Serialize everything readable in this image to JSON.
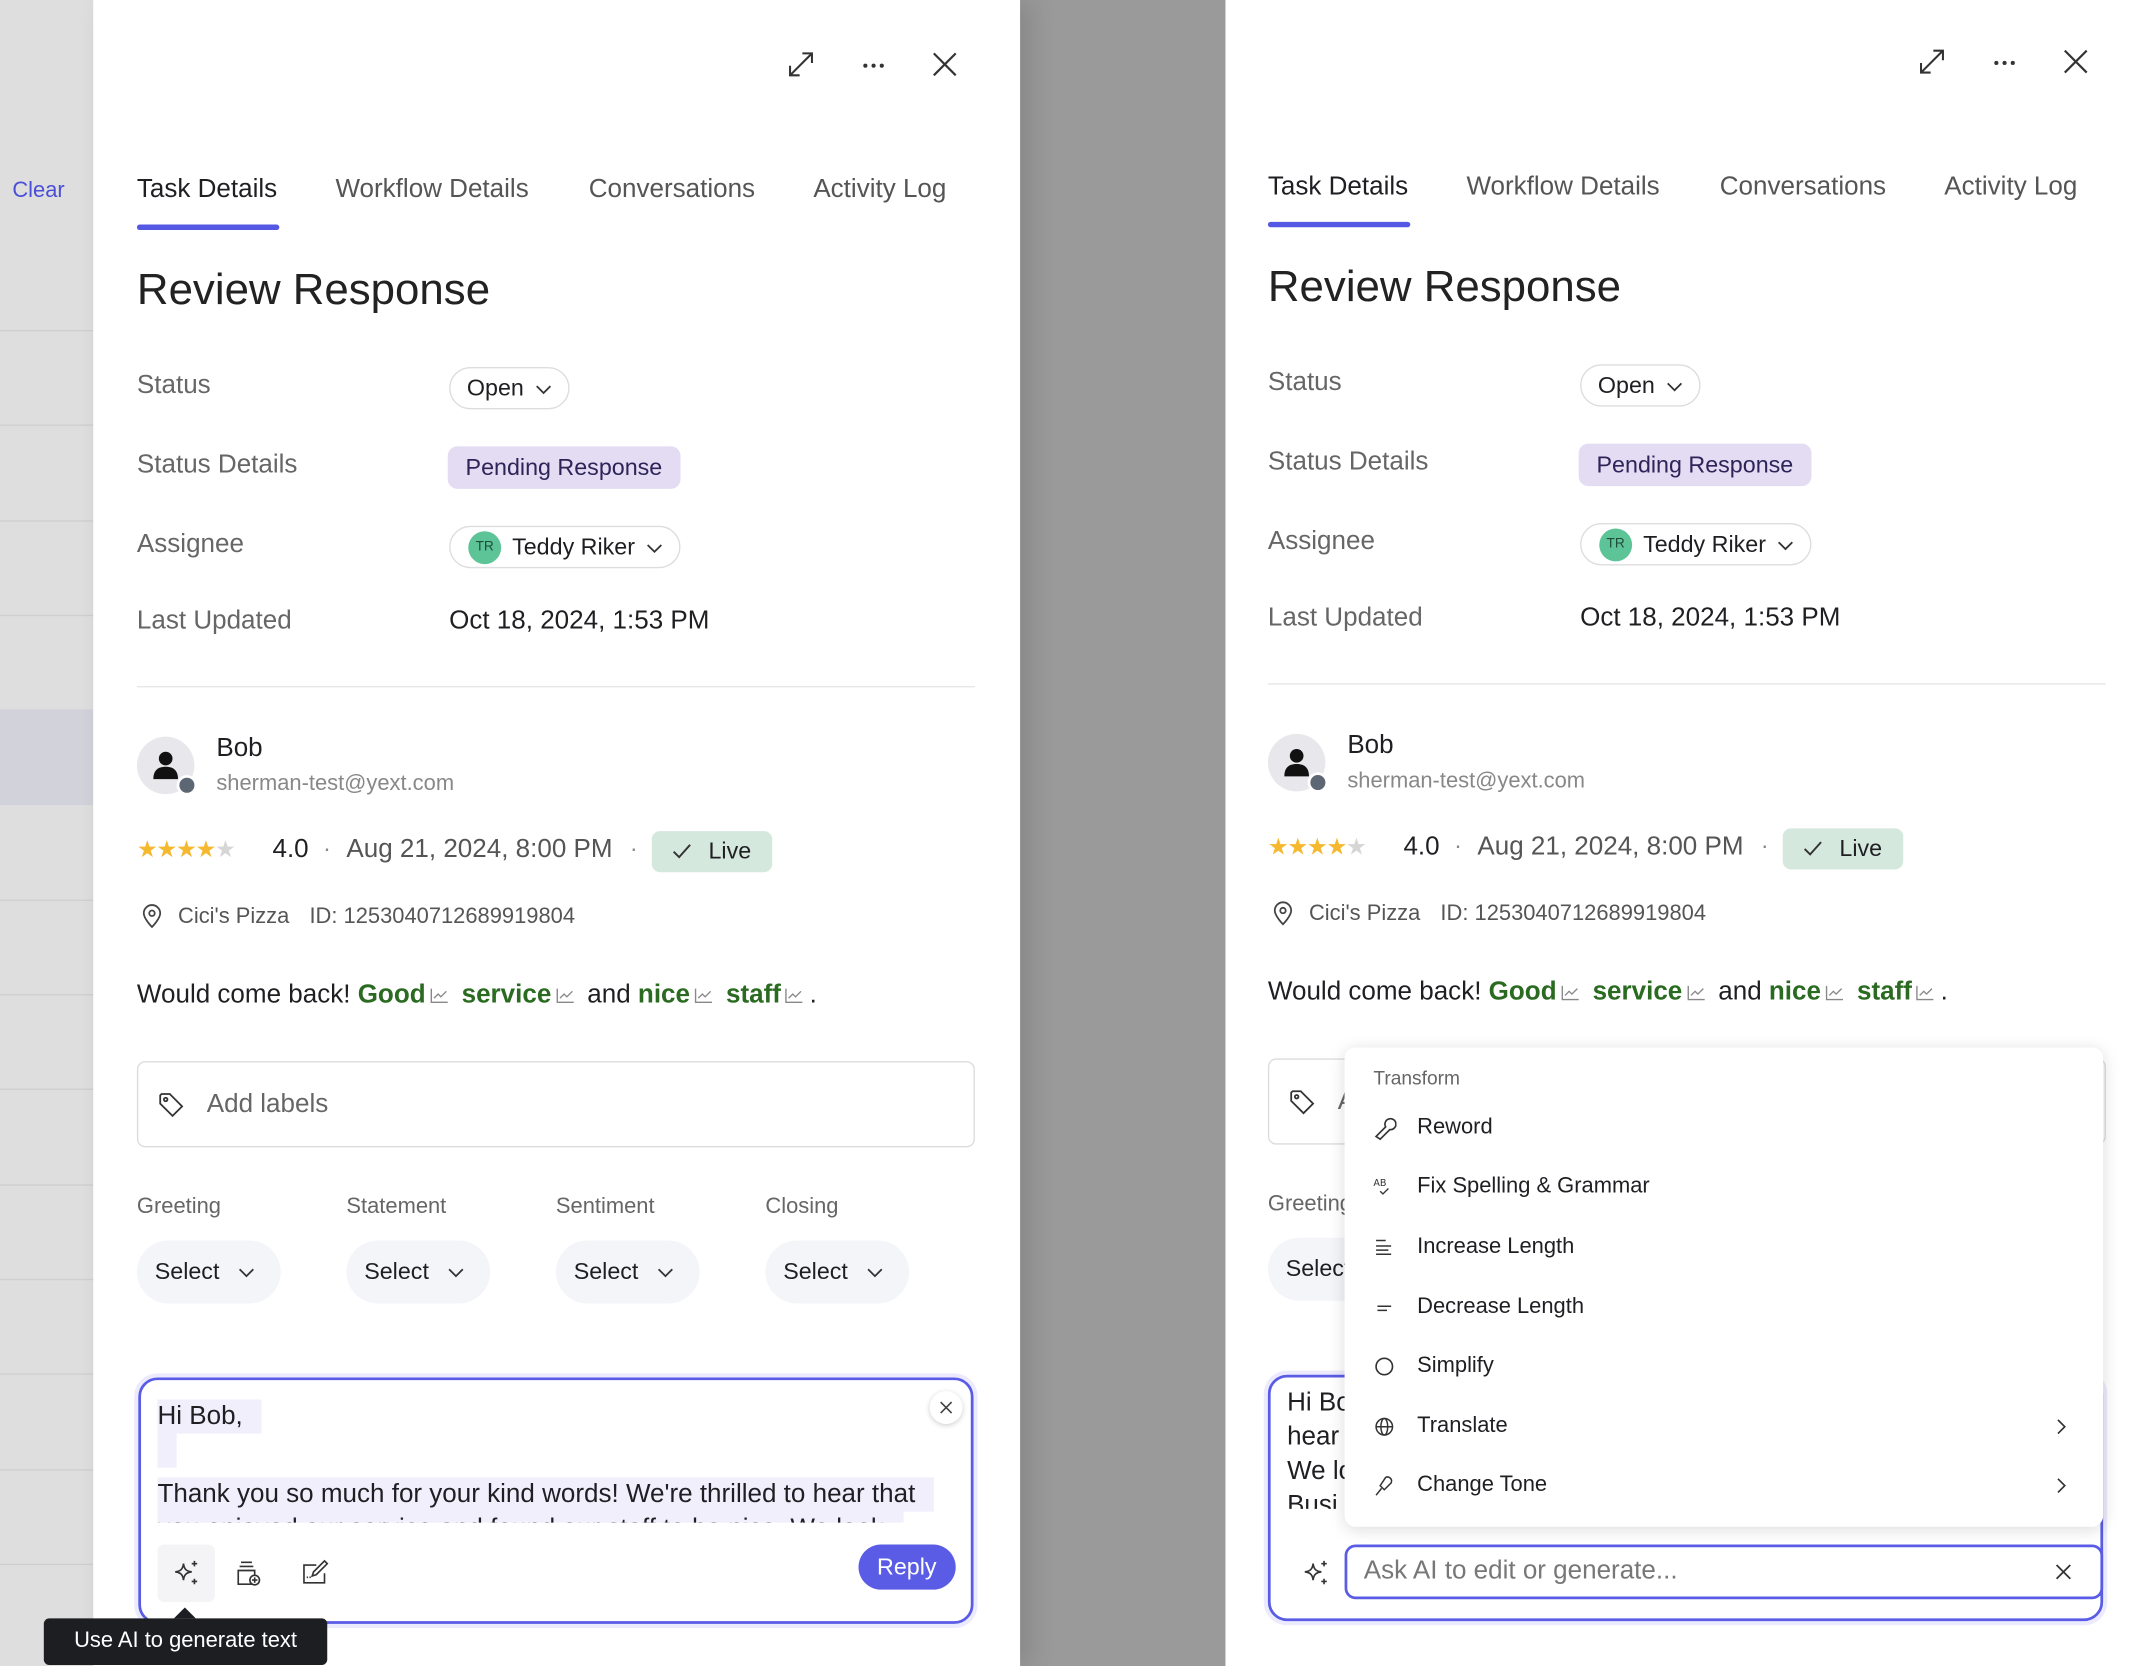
{
  "background_list": {
    "clear_label": "Clear"
  },
  "header": {
    "icons": [
      "expand-icon",
      "more-icon",
      "close-icon"
    ]
  },
  "tabs": [
    {
      "label": "Task Details",
      "active": true
    },
    {
      "label": "Workflow Details",
      "active": false
    },
    {
      "label": "Conversations",
      "active": false
    },
    {
      "label": "Activity Log",
      "active": false
    }
  ],
  "page_title": "Review Response",
  "fields": {
    "status_label": "Status",
    "status_value": "Open",
    "status_details_label": "Status Details",
    "status_details_value": "Pending Response",
    "assignee_label": "Assignee",
    "assignee_initials": "TR",
    "assignee_name": "Teddy Riker",
    "last_updated_label": "Last Updated",
    "last_updated_value": "Oct 18, 2024, 1:53 PM"
  },
  "review": {
    "author": "Bob",
    "email": "sherman-test@yext.com",
    "rating": "4.0",
    "stars_filled": 4,
    "stars_total": 5,
    "separator": "·",
    "date": "Aug 21, 2024, 8:00 PM",
    "publish_status": "Live",
    "location_name": "Cici's Pizza",
    "location_id": "ID: 1253040712689919804",
    "text_parts": [
      "Would come back! ",
      "Good",
      "service",
      "and ",
      "nice",
      "staff",
      "."
    ]
  },
  "labels": {
    "placeholder": "Add labels"
  },
  "dropdowns": [
    {
      "label": "Greeting",
      "value": "Select"
    },
    {
      "label": "Statement",
      "value": "Select"
    },
    {
      "label": "Sentiment",
      "value": "Select"
    },
    {
      "label": "Closing",
      "value": "Select"
    }
  ],
  "compose": {
    "lines": [
      "Hi Bob,",
      "",
      "Thank you so much for your kind words! We're thrilled to hear that",
      "you enjoyed our service and found our staff to be nice. We look"
    ],
    "right_visible_lines": [
      "Hi Bo",
      "hear",
      "We lo",
      "Busi"
    ],
    "reply_label": "Reply",
    "tooltip": "Use AI to generate text"
  },
  "ai_menu": {
    "section": "Transform",
    "items": [
      {
        "label": "Reword",
        "icon": "wrench-icon"
      },
      {
        "label": "Fix Spelling & Grammar",
        "icon": "spellcheck-icon"
      },
      {
        "label": "Increase Length",
        "icon": "increase-length-icon"
      },
      {
        "label": "Decrease Length",
        "icon": "decrease-length-icon"
      },
      {
        "label": "Simplify",
        "icon": "circle-icon"
      },
      {
        "label": "Translate",
        "icon": "globe-icon",
        "submenu": true
      },
      {
        "label": "Change Tone",
        "icon": "mic-icon",
        "submenu": true
      }
    ],
    "input_placeholder": "Ask AI to edit or generate..."
  },
  "colors": {
    "accent": "#5a5ce6",
    "keyword_green": "#2a6b21",
    "pending_bg": "#e3dcf3",
    "live_bg": "#d5e8dd",
    "star": "#f5b82e"
  }
}
